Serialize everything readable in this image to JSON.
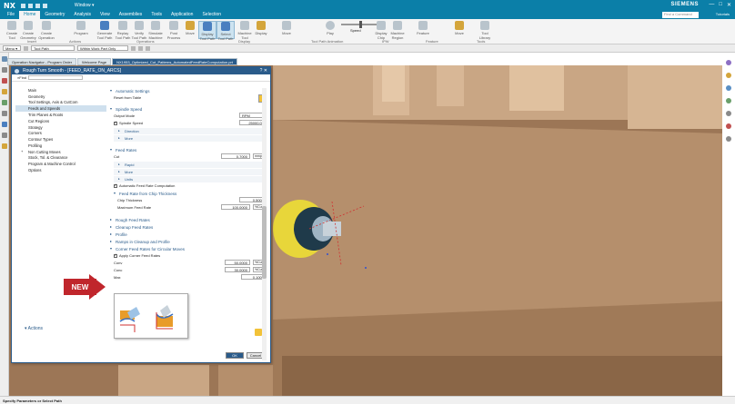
{
  "app": {
    "logo": "NX",
    "window_menu": "Window ▾",
    "brand": "SIEMENS",
    "search_placeholder": "Find a Command",
    "tutorials": "Tutorials"
  },
  "menu": [
    "File",
    "Home",
    "Geometry",
    "Analysis",
    "View",
    "Assemblies",
    "Tools",
    "Application",
    "Selection"
  ],
  "ribbon": {
    "buttons": [
      "Create Tool",
      "Create Geometry",
      "Create Operation",
      "Program",
      "Generate Tool Path",
      "Replay Tool Path",
      "Verify Tool Path",
      "Simulate Machine",
      "Post Process",
      "Move",
      "Display Tool Path",
      "Select Tool Path",
      "Machine Tool",
      "Display",
      "Move",
      "Play",
      "Display Chip",
      "Machine Region",
      "Feature",
      "Move",
      "Tool Library"
    ],
    "groups": [
      "Insert",
      "Actions",
      "Operations",
      "Display",
      "Tool Path Animation",
      "IPW",
      "Feature",
      "Tools"
    ],
    "speed_label": "Speed"
  },
  "toolbar2": {
    "menu_label": "Menu ▾",
    "filter1": "Tool Path",
    "filter2": "Within Work Part Only"
  },
  "tabs": [
    "Operation Navigator - Program Order",
    "Welcome Page",
    "NX1953_Optimized_Cut_Patterns_AutomatedFeedRateComputation.prt"
  ],
  "dialog": {
    "title": "Rough Turn Smooth - [FEED_RATE_ON_ARCS]",
    "find_label": "Find",
    "nav_items": [
      "Main",
      "Geometry",
      "Tool Settings, Axis & CutCom",
      "Feeds and Speeds",
      "Trim Planes & Roots",
      "Cut Regions",
      "Strategy",
      "Corners",
      "Contour Types",
      "Profiling",
      "Non Cutting Moves",
      "Stock, Tol. & Clearance",
      "Program & Machine Control",
      "Options"
    ],
    "sections": {
      "auto_settings": "Automatic Settings",
      "reset_from_table": "Reset from Table",
      "spindle_speed": "Spindle Speed",
      "output_mode_label": "Output Mode",
      "output_mode_value": "RPM",
      "spindle_speed_label": "Spindle Speed",
      "spindle_speed_value": "25000.00",
      "direction": "Direction",
      "more": "More",
      "feed_rates": "Feed Rates",
      "cut_label": "Cut",
      "cut_value": "0.7000",
      "cut_unit": "mmpr",
      "rapid": "Rapid",
      "more2": "More",
      "units": "Units",
      "auto_feed_comp": "Automatic Feed Rate Computation",
      "feed_from_chip": "Feed Rate from Chip Thickness",
      "chip_thickness_label": "Chip Thickness",
      "chip_thickness_value": "0.5000",
      "max_feed_label": "Maximum Feed Rate",
      "max_feed_value": "100.0000",
      "max_feed_unit": "%Cut",
      "rough_feed": "Rough Feed Rates",
      "cleanup_feed": "Cleanup Feed Rates",
      "profile": "Profile",
      "ramps": "Ramps in Cleanup and Profile",
      "corner_feed": "Corner Feed Rates for Circular Moves",
      "apply_corner": "Apply Corner Feed Rates",
      "corner1_label": "Conv",
      "corner1_value": "50.0000",
      "corner1_unit": "%Cut",
      "corner2_label": "Conc",
      "corner2_value": "30.0000",
      "corner2_unit": "%Cut",
      "corner3_label": "Max",
      "corner3_value": "0.1000"
    },
    "actions": "Actions",
    "ok": "OK",
    "cancel": "Cancel"
  },
  "badge": "NEW",
  "status": "Specify Parameters or Select Path",
  "colors": {
    "titlebar": "#0b7fa8",
    "dialog_title": "#2a5b8a",
    "viewport": "#8e6b4e",
    "new_badge": "#c0262c"
  }
}
